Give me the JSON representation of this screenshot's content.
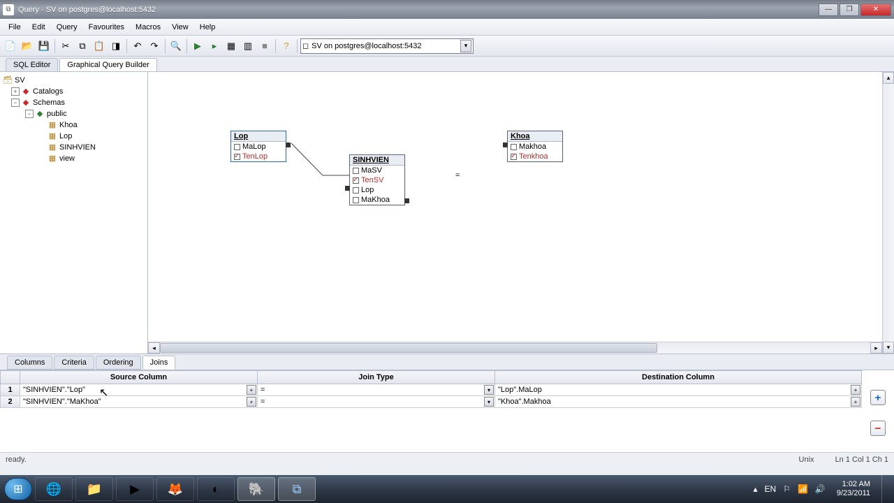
{
  "window": {
    "title": "Query - SV on postgres@localhost:5432"
  },
  "menu": [
    "File",
    "Edit",
    "Query",
    "Favourites",
    "Macros",
    "View",
    "Help"
  ],
  "connection": "SV on postgres@localhost:5432",
  "editor_tabs": {
    "sql": "SQL Editor",
    "gqb": "Graphical Query Builder"
  },
  "tree": {
    "root": "SV",
    "catalogs": "Catalogs",
    "schemas": "Schemas",
    "public": "public",
    "tables": [
      "Khoa",
      "Lop",
      "SINHVIEN",
      "view"
    ]
  },
  "diagram": {
    "lop": {
      "name": "Lop",
      "cols": [
        {
          "n": "MaLop",
          "c": false
        },
        {
          "n": "TenLop",
          "c": true
        }
      ]
    },
    "sv": {
      "name": "SINHVIEN",
      "cols": [
        {
          "n": "MaSV",
          "c": false
        },
        {
          "n": "TenSV",
          "c": true
        },
        {
          "n": "Lop",
          "c": false
        },
        {
          "n": "MaKhoa",
          "c": false
        }
      ]
    },
    "khoa": {
      "name": "Khoa",
      "cols": [
        {
          "n": "Makhoa",
          "c": false
        },
        {
          "n": "Tenkhoa",
          "c": true
        }
      ]
    },
    "eq": "="
  },
  "bottom_tabs": {
    "columns": "Columns",
    "criteria": "Criteria",
    "ordering": "Ordering",
    "joins": "Joins"
  },
  "grid": {
    "headers": {
      "src": "Source Column",
      "jt": "Join Type",
      "dst": "Destination Column"
    },
    "rows": [
      {
        "n": "1",
        "src": "\"SINHVIEN\".\"Lop\"",
        "jt": "=",
        "dst": "\"Lop\".MaLop"
      },
      {
        "n": "2",
        "src": "\"SINHVIEN\".\"MaKhoa\"",
        "jt": "=",
        "dst": "\"Khoa\".Makhoa"
      }
    ]
  },
  "status": {
    "ready": "ready.",
    "unix": "Unix",
    "pos": "Ln 1 Col 1 Ch 1"
  },
  "tray": {
    "lang": "EN",
    "time": "1:02 AM",
    "date": "9/23/2011"
  }
}
